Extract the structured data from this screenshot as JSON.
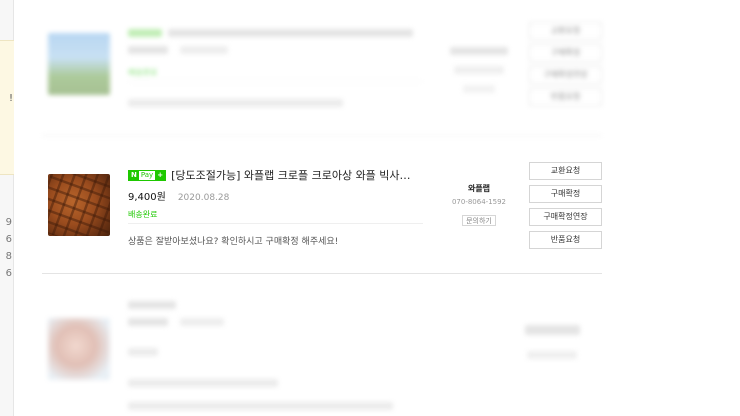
{
  "left_panel": {
    "edge_char": "!",
    "numbers": [
      "9",
      "6",
      "8",
      "6"
    ]
  },
  "orders": [
    {
      "blurred": true,
      "status": "배송완료",
      "actions": [
        "교환요청",
        "구매확정",
        "구매확정연장",
        "반품요청"
      ]
    },
    {
      "blurred": false,
      "npay": {
        "n": "N",
        "pay": "Pay",
        "plus": "+"
      },
      "title": "[당도조절가능] 와플랩 크로플 크로아상 와플 빅사…",
      "price": "9,400원",
      "date": "2020.08.28",
      "status": "배송완료",
      "message": "상품은 잘받아보셨나요? 확인하시고 구매확정 해주세요!",
      "seller": {
        "name": "와플랩",
        "phone": "070-8064-1592",
        "inquiry": "문의하기"
      },
      "actions": [
        "교환요청",
        "구매확정",
        "구매확정연장",
        "반품요청"
      ]
    },
    {
      "blurred": true
    }
  ],
  "colors": {
    "npay_green": "#1ec800",
    "status_green": "#1ec800",
    "divider": "#e4e4e4"
  }
}
